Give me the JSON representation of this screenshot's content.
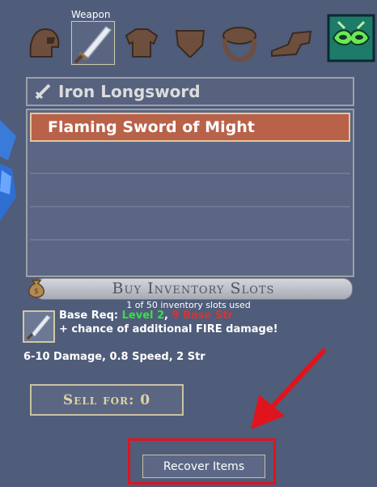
{
  "equipment": {
    "selected_slot_label": "Weapon",
    "slots": [
      {
        "icon": "helmet-icon"
      },
      {
        "icon": "sword-icon",
        "selected": true
      },
      {
        "icon": "chest-armor-icon"
      },
      {
        "icon": "leg-armor-icon"
      },
      {
        "icon": "shield-icon"
      },
      {
        "icon": "ring-icon"
      },
      {
        "icon": "boots-icon"
      },
      {
        "icon": "mask-icon"
      }
    ]
  },
  "equipped_item": {
    "name": "Iron Longsword"
  },
  "item_list": {
    "rows": [
      "Flaming Sword of Might",
      "",
      "",
      "",
      ""
    ],
    "selected_index": 0
  },
  "inventory": {
    "buy_label": "Buy Inventory Slots",
    "slots_used_text": "1 of 50 inventory slots used"
  },
  "item_detail": {
    "req_prefix": "Base Req: ",
    "req_level": "Level 2",
    "req_sep": ", ",
    "req_str": "9 Base Str",
    "bonus_text": "+ chance of additional FIRE damage!",
    "stats_text": "6-10 Damage, 0.8 Speed, 2 Str"
  },
  "actions": {
    "sell_label": "Sell for: 0",
    "recover_label": "Recover Items"
  },
  "colors": {
    "background": "#4f5c7a",
    "selected_row": "#b8624a",
    "level_req": "#36e04a",
    "str_req": "#d6352e",
    "highlight_box": "#e0141c"
  }
}
